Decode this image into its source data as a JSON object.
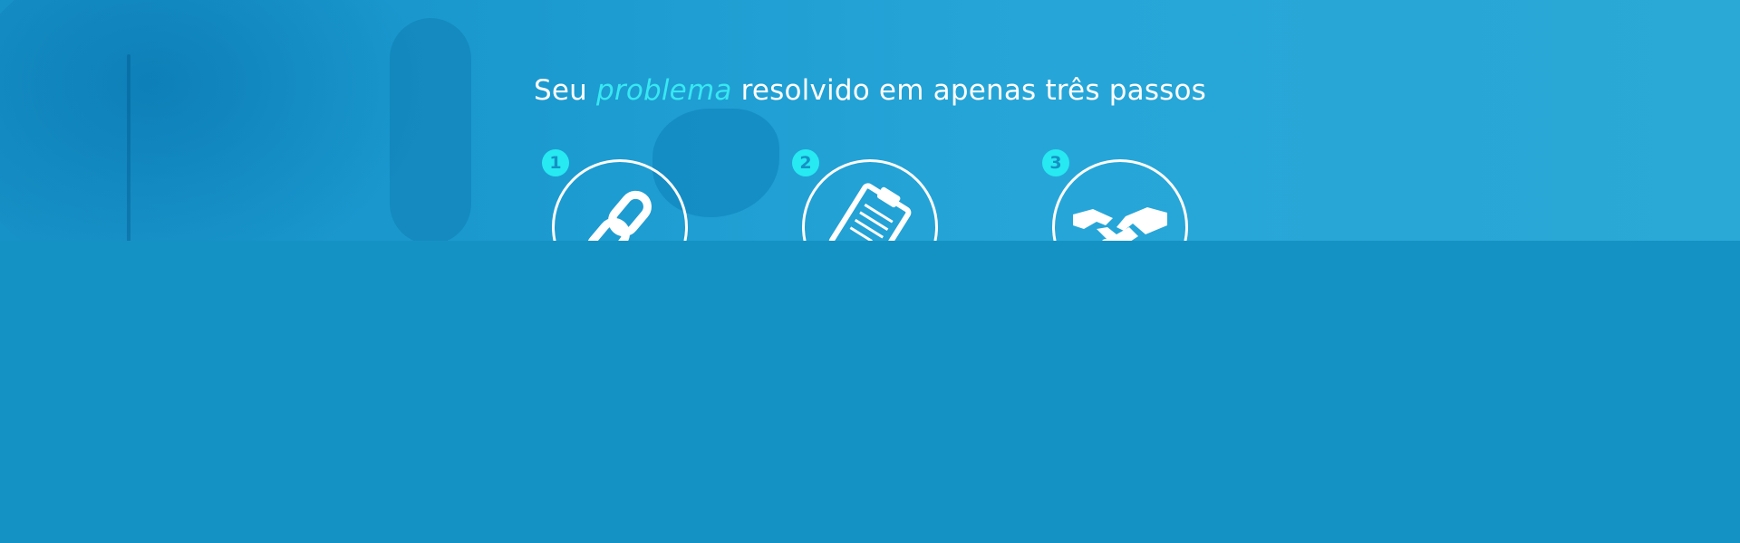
{
  "hero": {
    "title_prefix": "Seu ",
    "title_highlight": "problema",
    "title_suffix": " resolvido em apenas três passos"
  },
  "steps": [
    {
      "number": "1",
      "icon": "link-icon"
    },
    {
      "number": "2",
      "icon": "clipboard-icon"
    },
    {
      "number": "3",
      "icon": "handshake-icon"
    }
  ],
  "colors": {
    "background": "#1592c4",
    "accent": "#27e9f2",
    "text": "#ffffff"
  }
}
